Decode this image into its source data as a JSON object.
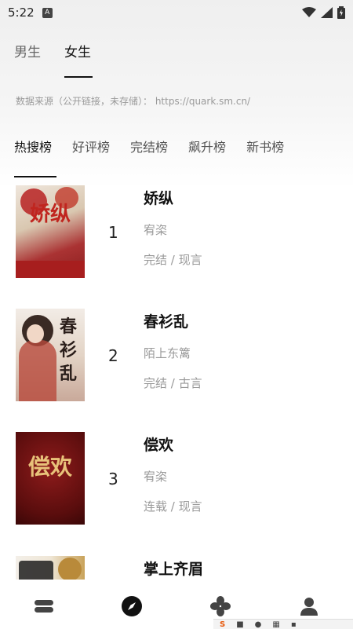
{
  "status": {
    "time": "5:22",
    "notif_glyph": "A"
  },
  "gender_tabs": [
    {
      "label": "男生"
    },
    {
      "label": "女生"
    }
  ],
  "source_text": "数据来源（公开链接，未存储）：  https://quark.sm.cn/",
  "rank_tabs": [
    {
      "label": "热搜榜"
    },
    {
      "label": "好评榜"
    },
    {
      "label": "完结榜"
    },
    {
      "label": "飙升榜"
    },
    {
      "label": "新书榜"
    }
  ],
  "books": [
    {
      "rank": "1",
      "title": "娇纵",
      "author": "宥栥",
      "meta": "完结 / 现言",
      "cover_text": "娇纵"
    },
    {
      "rank": "2",
      "title": "春衫乱",
      "author": "陌上东篱",
      "meta": "完结 / 古言",
      "cover_text": "春衫乱"
    },
    {
      "rank": "3",
      "title": "偿欢",
      "author": "宥栥",
      "meta": "连载 / 现言",
      "cover_text": "偿欢"
    },
    {
      "rank": "4",
      "title": "掌上齐眉",
      "author": "",
      "meta": "",
      "cover_text": ""
    }
  ],
  "colors": {
    "accent": "#111111",
    "muted": "#999999"
  }
}
